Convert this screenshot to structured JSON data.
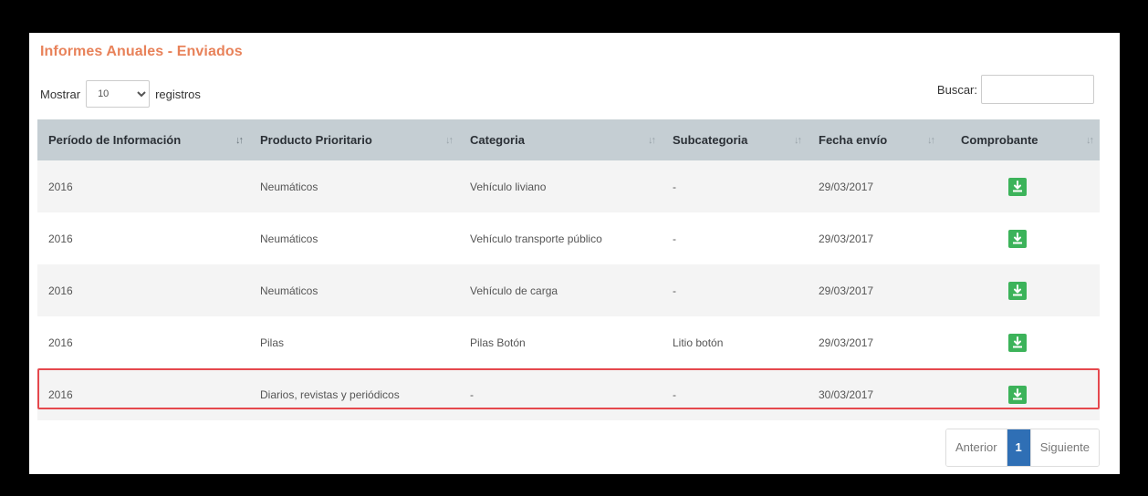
{
  "page": {
    "title": "Informes Anuales - Enviados"
  },
  "length": {
    "prefix": "Mostrar",
    "value": "10",
    "suffix": "registros"
  },
  "search": {
    "label": "Buscar:",
    "value": ""
  },
  "table": {
    "headers": [
      "Período de Información",
      "Producto Prioritario",
      "Categoria",
      "Subcategoria",
      "Fecha envío",
      "Comprobante"
    ],
    "rows": [
      [
        "2016",
        "Neumáticos",
        "Vehículo liviano",
        "-",
        "29/03/2017",
        "download-icon"
      ],
      [
        "2016",
        "Neumáticos",
        "Vehículo transporte público",
        "-",
        "29/03/2017",
        "download-icon"
      ],
      [
        "2016",
        "Neumáticos",
        "Vehículo de carga",
        "-",
        "29/03/2017",
        "download-icon"
      ],
      [
        "2016",
        "Pilas",
        "Pilas Botón",
        "Litio botón",
        "29/03/2017",
        "download-icon"
      ],
      [
        "2016",
        "Diarios, revistas y periódicos",
        "-",
        "-",
        "30/03/2017",
        "download-icon"
      ]
    ],
    "highlighted_row": 4
  },
  "pagination": {
    "prev": "Anterior",
    "current": "1",
    "next": "Siguiente"
  },
  "colors": {
    "title": "#e8825a",
    "header_bg": "#c5ced3",
    "download": "#3cb35a",
    "highlight": "#e5484d",
    "page_active": "#2f6fb5"
  }
}
